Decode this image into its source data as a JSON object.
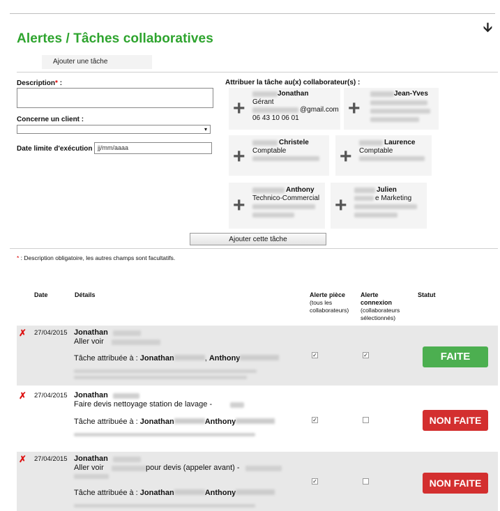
{
  "header": {
    "title": "Alertes / Tâches collaboratives",
    "arrow_icon": "arrow-down-icon"
  },
  "tab": {
    "label": "Ajouter une tâche"
  },
  "form": {
    "description_label": "Description",
    "required_mark": "*",
    "description_suffix": " :",
    "client_label": "Concerne un client :",
    "client_value": "▾",
    "deadline_label": "Date limite d'exécution :",
    "deadline_placeholder": "jj/mm/aaaa",
    "assign_label": "Attribuer la tâche au(x) collaborateur(s) :",
    "submit_label": "Ajouter cette tâche",
    "footnote_mark": "*",
    "footnote": " : Description obligatoire, les autres champs sont facultatifs."
  },
  "collaborators": [
    {
      "name": "Jonathan",
      "role": "Gérant",
      "email_suffix": "@gmail.com",
      "phone": "06 43 10 06 01"
    },
    {
      "name": "Jean-Yves",
      "role": "",
      "email_suffix": "",
      "phone": ""
    },
    {
      "name": "Christele",
      "role": "Comptable",
      "email_suffix": "",
      "phone": ""
    },
    {
      "name": "Laurence",
      "role": "Comptable",
      "email_suffix": "",
      "phone": ""
    },
    {
      "name": "Anthony",
      "role": "Technico-Commercial",
      "email_suffix": "",
      "phone": ""
    },
    {
      "name": "Julien",
      "role": "e Marketing",
      "email_suffix": "",
      "phone": ""
    }
  ],
  "table": {
    "headers": {
      "date": "Date",
      "details": "Détails",
      "alert_piece": "Alerte pièce",
      "alert_piece_sub1": "(tous les",
      "alert_piece_sub2": "collaborateurs)",
      "alert_conn": "Alerte",
      "alert_conn_2": "connexion",
      "alert_conn_sub1": "(collaborateurs",
      "alert_conn_sub2": "sélectionnés)",
      "status": "Statut"
    },
    "rows": [
      {
        "date": "27/04/2015",
        "name": "Jonathan",
        "text": "Aller voir",
        "assigned_prefix": "Tâche attribuée à : ",
        "assignee1": "Jonathan",
        "sep": ", ",
        "assignee2": "Anthony",
        "alert_piece": true,
        "alert_conn": true,
        "status": "FAITE"
      },
      {
        "date": "27/04/2015",
        "name": "Jonathan",
        "text": "Faire devis nettoyage station de lavage -",
        "assigned_prefix": "Tâche attribuée à : ",
        "assignee1": "Jonathan",
        "sep": "",
        "assignee2": "Anthony",
        "alert_piece": true,
        "alert_conn": false,
        "status": "NON FAITE"
      },
      {
        "date": "27/04/2015",
        "name": "Jonathan",
        "text": "Aller voir",
        "text2": "pour devis (appeler avant) -",
        "assigned_prefix": "Tâche attribuée à : ",
        "assignee1": "Jonathan",
        "sep": "",
        "assignee2": "Anthony",
        "alert_piece": true,
        "alert_conn": false,
        "status": "NON FAITE"
      }
    ]
  },
  "colors": {
    "title": "#2ea42e",
    "done": "#4caf50",
    "todo": "#d32f2f",
    "delete": "#dd1111"
  }
}
